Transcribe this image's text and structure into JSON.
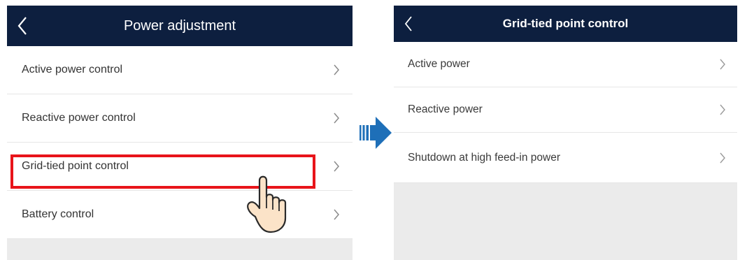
{
  "left_screen": {
    "header": {
      "title": "Power adjustment",
      "back_icon": "chevron-left-icon"
    },
    "items": [
      {
        "label": "Active power control"
      },
      {
        "label": "Reactive power control"
      },
      {
        "label": "Grid-tied point control",
        "highlighted": true
      },
      {
        "label": "Battery control"
      }
    ]
  },
  "transition_arrow_icon": "arrow-right-icon",
  "right_screen": {
    "header": {
      "title": "Grid-tied point control",
      "back_icon": "chevron-left-icon"
    },
    "items": [
      {
        "label": "Active power"
      },
      {
        "label": "Reactive power"
      },
      {
        "label": "Shutdown at high feed-in power"
      }
    ]
  },
  "colors": {
    "header_bg": "#0d1f3f",
    "highlight_border": "#e8141a",
    "arrow": "#1e6fb8",
    "filler_bg": "#ebebeb"
  }
}
